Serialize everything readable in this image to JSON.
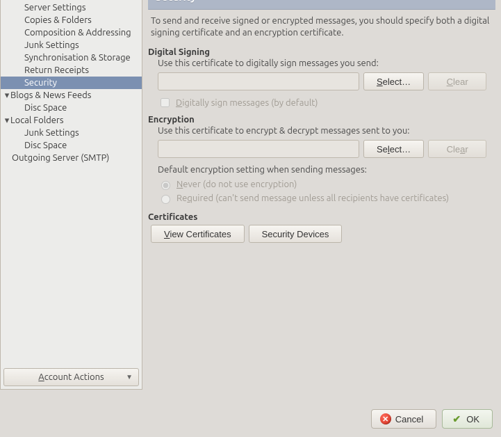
{
  "sidebar": {
    "items": [
      {
        "label": "Server Settings",
        "level": 1
      },
      {
        "label": "Copies & Folders",
        "level": 1
      },
      {
        "label": "Composition & Addressing",
        "level": 1
      },
      {
        "label": "Junk Settings",
        "level": 1
      },
      {
        "label": "Synchronisation & Storage",
        "level": 1
      },
      {
        "label": "Return Receipts",
        "level": 1
      },
      {
        "label": "Security",
        "level": 1,
        "selected": true
      },
      {
        "label": "Blogs & News Feeds",
        "level": 0
      },
      {
        "label": "Disc Space",
        "level": 1
      },
      {
        "label": "Local Folders",
        "level": 0
      },
      {
        "label": "Junk Settings",
        "level": 1
      },
      {
        "label": "Disc Space",
        "level": 1
      },
      {
        "label": "Outgoing Server (SMTP)",
        "level": 0,
        "notwist": true
      }
    ],
    "account_actions": "Account Actions"
  },
  "panel": {
    "title": "Security",
    "description": "To send and receive signed or encrypted messages, you should specify both a digital signing certificate and an encryption certificate.",
    "signing": {
      "heading": "Digital Signing",
      "sub": "Use this certificate to digitally sign messages you send:",
      "value": "",
      "select": "Select…",
      "clear": "Clear",
      "sign_default": "Digitally sign messages (by default)"
    },
    "encryption": {
      "heading": "Encryption",
      "sub": "Use this certificate to encrypt & decrypt messages sent to you:",
      "value": "",
      "select": "Select…",
      "clear": "Clear",
      "default_setting": "Default encryption setting when sending messages:",
      "never": "Never (do not use encryption)",
      "required": "Required (can't send message unless all recipients have certificates)"
    },
    "certs": {
      "heading": "Certificates",
      "view": "View Certificates",
      "devices": "Security Devices"
    }
  },
  "footer": {
    "cancel": "Cancel",
    "ok": "OK"
  }
}
